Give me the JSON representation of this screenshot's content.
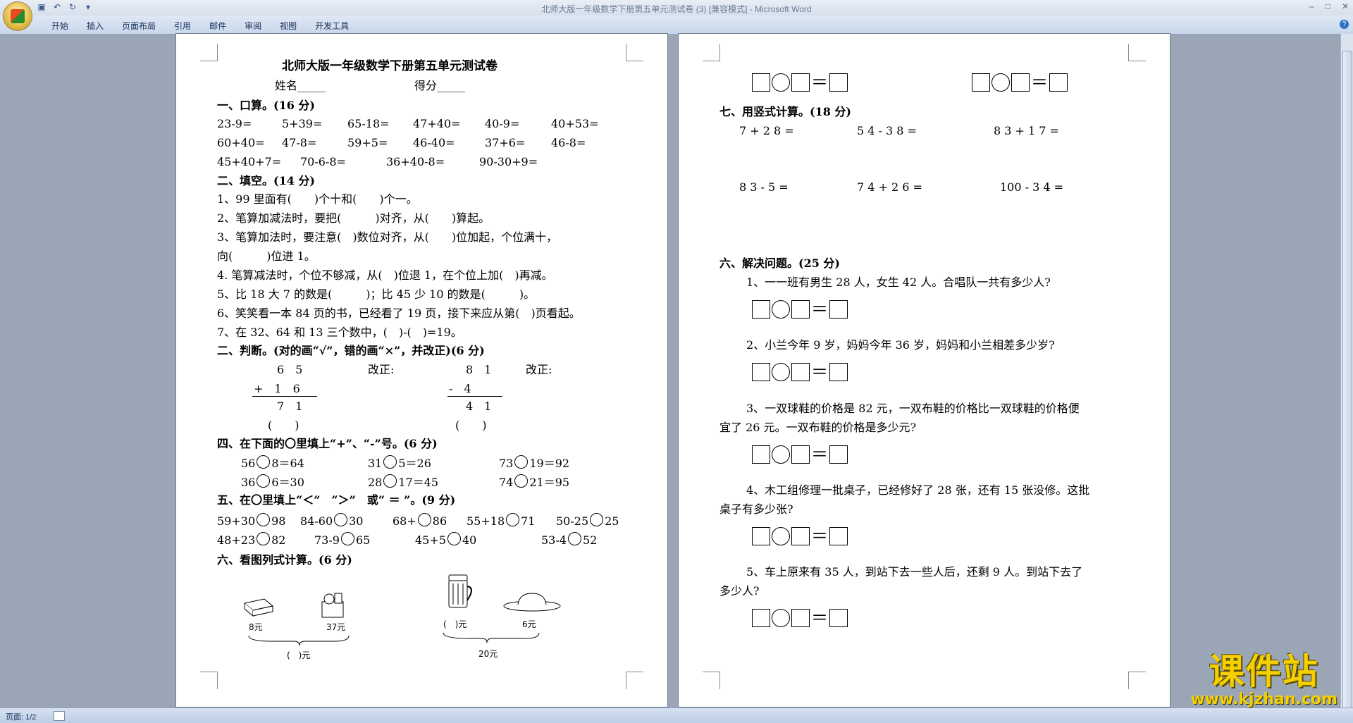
{
  "window": {
    "title": "北师大版一年级数学下册第五单元测试卷 (3) [兼容模式] - Microsoft Word",
    "tabs": [
      "开始",
      "插入",
      "页面布局",
      "引用",
      "邮件",
      "审阅",
      "视图",
      "开发工具"
    ],
    "help": "?"
  },
  "status": {
    "page": "页面: 1/2"
  },
  "watermark": {
    "brand": "课件站",
    "url": "www.kjzhan.com"
  },
  "p1": {
    "title": "北师大版一年级数学下册第五单元测试卷",
    "name": "姓名_____",
    "score": "得分_____",
    "s1": {
      "head": "一、口算。(16 分)",
      "r1": [
        "23-9=",
        "5+39=",
        "65-18=",
        "47+40=",
        "40-9=",
        "40+53="
      ],
      "r2": [
        "60+40=",
        "47-8=",
        "59+5=",
        "46-40=",
        "37+6=",
        "46-8="
      ],
      "r3": [
        "45+40+7=",
        "70-6-8=",
        "36+40-8=",
        "90-30+9="
      ]
    },
    "s2": {
      "head": "二、填空。(14 分)",
      "items": [
        "1、99 里面有(　　)个十和(　　)个一。",
        "2、笔算加减法时，要把(　　　)对齐，从(　　)算起。",
        "3、笔算加法时，要注意(　)数位对齐，从(　　)位加起，个位满十，",
        "向(　　　)位进 1。",
        "4. 笔算减法时，个位不够减，从(　)位退 1，在个位上加(　)再减。",
        "5、比 18 大 7 的数是(　　　)；比 45 少 10 的数是(　　　)。",
        "6、笑笑看一本 84 页的书，已经看了 19 页，接下来应从第(　)页看起。",
        "7、在 32、64 和 13 三个数中，(　)-(　)=19。"
      ]
    },
    "s3": {
      "head": "二、判断。(对的画“√”，错的画“×”，并改正)(6 分)",
      "a_top": "6　5",
      "a_mid": "+　1　6",
      "a_bot": "7　1",
      "b_top": "8　1",
      "b_mid": "-　4",
      "b_bot": "4　1",
      "fix": "改正:",
      "paren": "(　　)"
    },
    "s4": {
      "head": "四、在下面的〇里填上“+”、“-”号。(6 分)",
      "r1": [
        [
          "56",
          "8＝64"
        ],
        [
          "31",
          "5＝26"
        ],
        [
          "73",
          "19＝92"
        ]
      ],
      "r2": [
        [
          "36",
          "6＝30"
        ],
        [
          "28",
          "17＝45"
        ],
        [
          "74",
          "21＝95"
        ]
      ]
    },
    "s5": {
      "head": "五、在〇里填上“＜”　“＞”　或“ ＝ ”。(9 分)",
      "r1": [
        [
          "59+30",
          "98"
        ],
        [
          "84-60",
          "30"
        ],
        [
          "68+",
          "86"
        ],
        [
          "55+18",
          "71"
        ],
        [
          "50-25",
          "25"
        ]
      ],
      "r2": [
        [
          "48+23",
          "82"
        ],
        [
          "73-9",
          "65"
        ],
        [
          "45+5",
          "40"
        ],
        [
          "53-4",
          "52"
        ]
      ]
    },
    "s6": {
      "head": "六、看图列式计算。(6 分)",
      "p1a": "8元",
      "p1b": "37元",
      "p1q": "(　)元",
      "p2a": "(　)元",
      "p2b": "6元",
      "p2q": "20元"
    }
  },
  "p2": {
    "s7": {
      "head": "七、用竖式计算。(18 分)",
      "r1": [
        "7 + 2 8 =",
        "5 4 - 3 8 =",
        "8 3 + 1 7 ="
      ],
      "r2": [
        "8 3 - 5 =",
        "7 4 + 2 6 =",
        "100 - 3 4 ="
      ]
    },
    "s8": {
      "head": "六、解决问题。(25 分)",
      "q1": "1、一一班有男生 28 人，女生 42 人。合唱队一共有多少人?",
      "q2": "2、小兰今年 9 岁，妈妈今年 36 岁，妈妈和小兰相差多少岁?",
      "q3a": "3、一双球鞋的价格是 82 元，一双布鞋的价格比一双球鞋的价格便",
      "q3b": "宜了 26 元。一双布鞋的价格是多少元?",
      "q4a": "4、木工组修理一批桌子，已经修好了 28 张，还有 15 张没修。这批",
      "q4b": "桌子有多少张?",
      "q5a": "5、车上原来有 35 人，到站下去一些人后，还剩 9 人。到站下去了",
      "q5b": "多少人?"
    },
    "eq": "＝"
  }
}
